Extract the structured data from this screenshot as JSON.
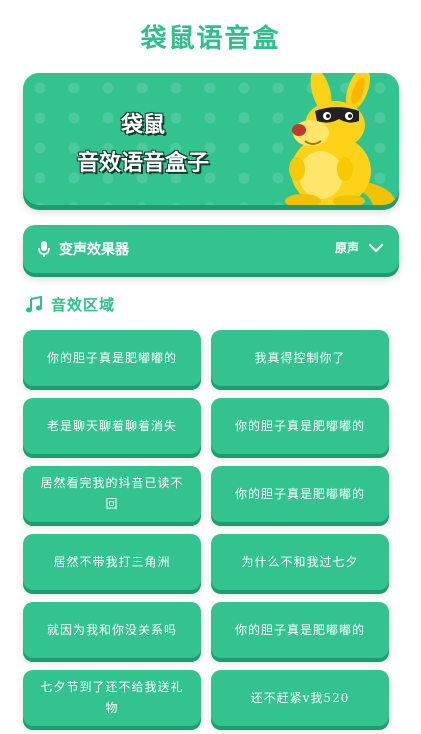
{
  "header": {
    "title": "袋鼠语音盒"
  },
  "banner": {
    "line1": "袋鼠",
    "line2": "音效语音盒子"
  },
  "voice_effect": {
    "label": "变声效果器",
    "value": "原声"
  },
  "section": {
    "label": "音效区域"
  },
  "sounds": [
    "你的胆子真是肥嘟嘟的",
    "我真得控制你了",
    "老是聊天聊着聊着消失",
    "你的胆子真是肥嘟嘟的",
    "居然看完我的抖音已读不回",
    "你的胆子真是肥嘟嘟的",
    "居然不带我打三角洲",
    "为什么不和我过七夕",
    "就因为我和你没关系吗",
    "你的胆子真是肥嘟嘟的",
    "七夕节到了还不给我送礼物",
    "还不赶紧v我520"
  ],
  "colors": {
    "primary": "#33c38f",
    "shadow": "#1e9c70",
    "title": "#2fbf8c"
  },
  "icons": [
    "microphone-icon",
    "chevron-down-icon",
    "music-note-icon"
  ]
}
